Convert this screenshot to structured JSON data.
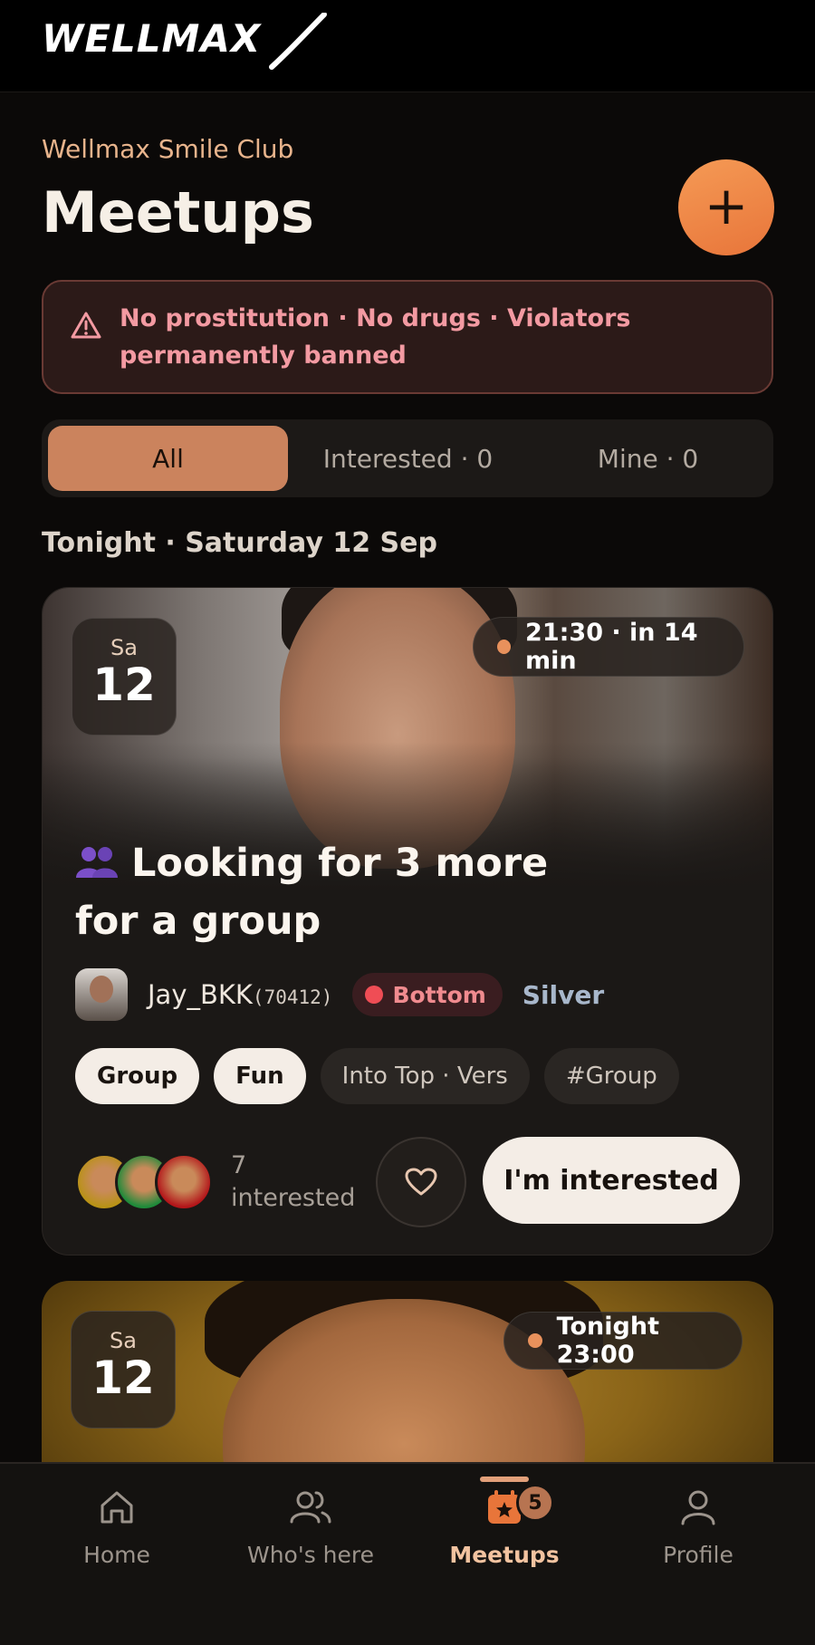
{
  "header": {
    "logo_text": "WELLMAX"
  },
  "club_name": "Wellmax Smile Club",
  "page_title": "Meetups",
  "add_button": {
    "icon": "plus-icon",
    "label": "+"
  },
  "warning": {
    "icon": "warning-triangle-icon",
    "text": "No prostitution · No drugs · Violators permanently banned"
  },
  "tabs": [
    {
      "label": "All",
      "active": true
    },
    {
      "label": "Interested · 0",
      "active": false
    },
    {
      "label": "Mine · 0",
      "active": false
    }
  ],
  "section_date": "Tonight · Saturday 12 Sep",
  "meetups": [
    {
      "date": {
        "dow": "Sa",
        "day": "12"
      },
      "time": "21:30 · in 14 min",
      "title_emoji": "group-icon",
      "title": "Looking for 3 more for a group",
      "author": {
        "name": "Jay_BKK",
        "id": "(70412)",
        "role": "Bottom",
        "tier": "Silver"
      },
      "tags": [
        {
          "label": "Group",
          "style": "light"
        },
        {
          "label": "Fun",
          "style": "light"
        },
        {
          "label": "Into Top · Vers",
          "style": "dark"
        },
        {
          "label": "#Group",
          "style": "dark"
        }
      ],
      "interested": {
        "count": "7",
        "label": "interested"
      },
      "cta": "I'm interested"
    },
    {
      "date": {
        "dow": "Sa",
        "day": "12"
      },
      "time": "Tonight 23:00"
    }
  ],
  "nav": [
    {
      "label": "Home",
      "icon": "home-icon"
    },
    {
      "label": "Who's here",
      "icon": "users-icon"
    },
    {
      "label": "Meetups",
      "icon": "calendar-star-icon",
      "active": true,
      "badge": "5"
    },
    {
      "label": "Profile",
      "icon": "user-icon"
    }
  ],
  "colors": {
    "accent": "#e8753a",
    "tab_active": "#cb835d",
    "warning_text": "#f39aa2",
    "background": "#0b0908"
  }
}
